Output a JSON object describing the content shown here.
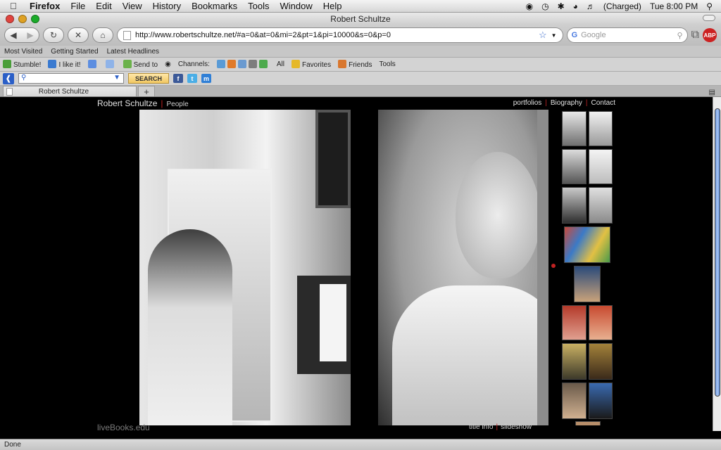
{
  "menubar": {
    "app": "Firefox",
    "items": [
      "File",
      "Edit",
      "View",
      "History",
      "Bookmarks",
      "Tools",
      "Window",
      "Help"
    ],
    "battery": "(Charged)",
    "clock": "Tue 8:00 PM"
  },
  "window": {
    "title": "Robert Schultze"
  },
  "navbar": {
    "url": "http://www.robertschultze.net/#a=0&at=0&mi=2&pt=1&pi=10000&s=0&p=0",
    "search_placeholder": "Google",
    "adblock_label": "ABP"
  },
  "bookmarks": [
    "Most Visited",
    "Getting Started",
    "Latest Headlines"
  ],
  "stumble_toolbar": {
    "stumble": "Stumble!",
    "like": "I like it!",
    "send": "Send to",
    "channels": "Channels:",
    "all": "All",
    "favorites": "Favorites",
    "friends": "Friends",
    "tools": "Tools"
  },
  "search_toolbar": {
    "button": "SEARCH"
  },
  "tab": {
    "title": "Robert Schultze",
    "new_tab": "+"
  },
  "site": {
    "name": "Robert Schultze",
    "section": "People",
    "nav": [
      "portfolios",
      "Biography",
      "Contact"
    ],
    "footer_brand": "liveBooks.edu",
    "footer_links": [
      "title info",
      "slideshow"
    ]
  },
  "status": "Done",
  "colors": {
    "accent_red": "#c02222"
  }
}
